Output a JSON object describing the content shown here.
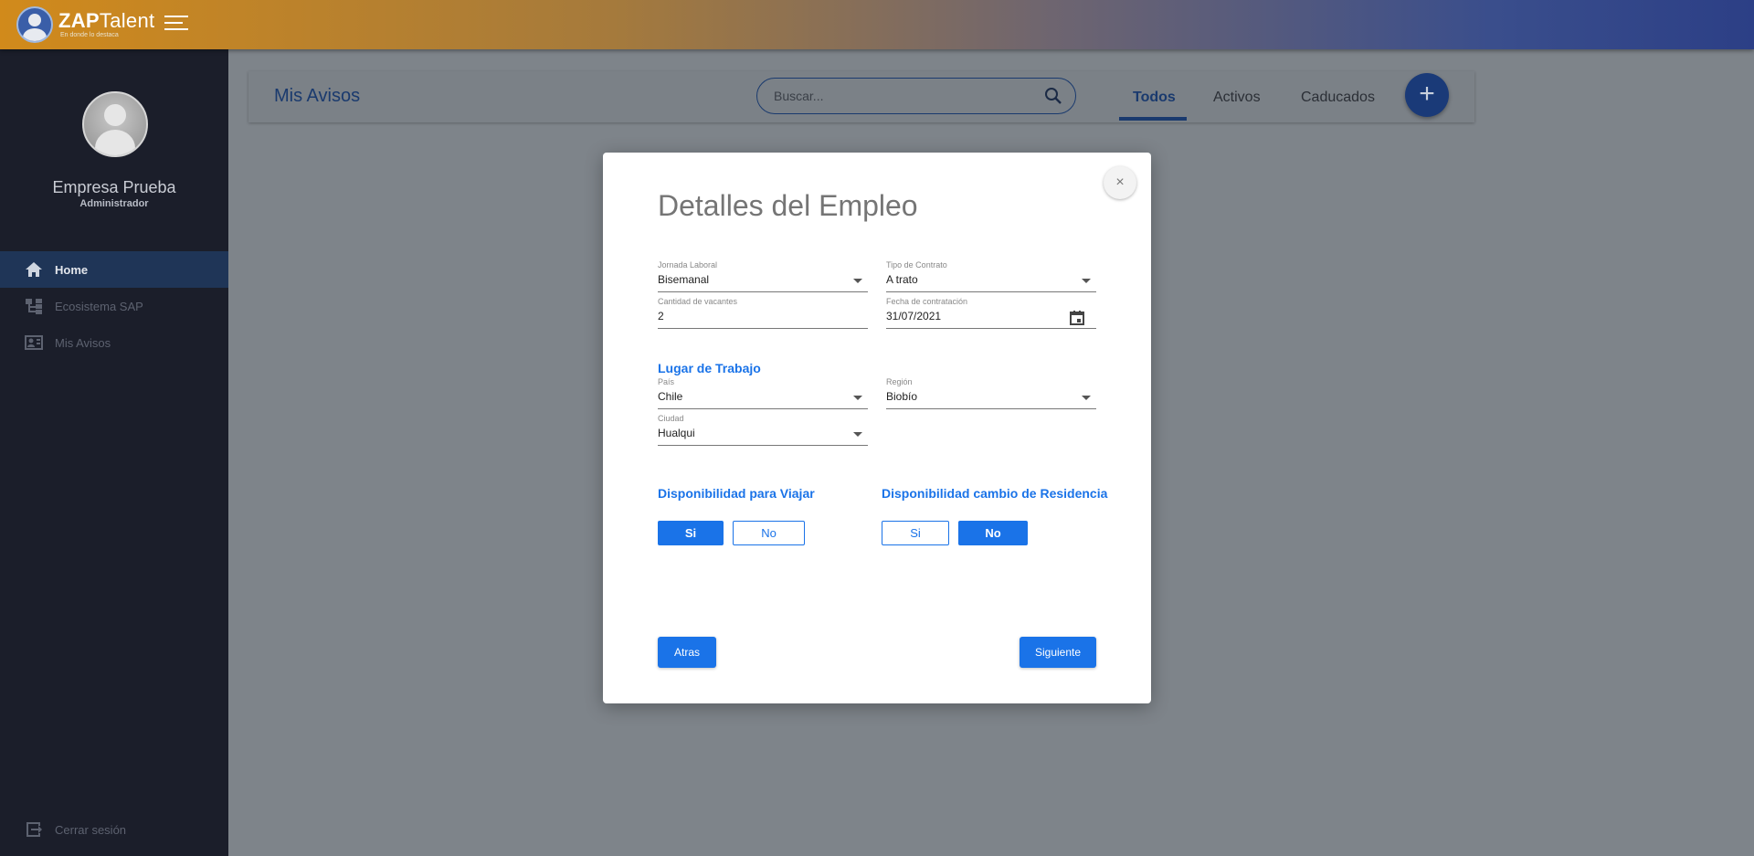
{
  "brand": {
    "name_bold": "ZAP",
    "name_thin": "Talent",
    "tagline": "En donde lo destaca"
  },
  "sidebar": {
    "company": "Empresa Prueba",
    "role": "Administrador",
    "items": [
      {
        "label": "Home",
        "icon": "home-icon",
        "active": true
      },
      {
        "label": "Ecosistema SAP",
        "icon": "tree-icon",
        "active": false
      },
      {
        "label": "Mis Avisos",
        "icon": "id-card-icon",
        "active": false
      }
    ],
    "logout": "Cerrar sesión"
  },
  "header": {
    "title": "Mis Avisos",
    "search_placeholder": "Buscar...",
    "tabs": [
      {
        "label": "Todos",
        "active": true
      },
      {
        "label": "Activos",
        "active": false
      },
      {
        "label": "Caducados",
        "active": false
      }
    ],
    "add_button": "+"
  },
  "modal": {
    "title": "Detalles del Empleo",
    "close": "×",
    "fields": {
      "jornada": {
        "label": "Jornada Laboral",
        "value": "Bisemanal"
      },
      "contrato": {
        "label": "Tipo de Contrato",
        "value": "A trato"
      },
      "vacantes": {
        "label": "Cantidad de vacantes",
        "value": "2"
      },
      "fecha": {
        "label": "Fecha de contratación",
        "value": "31/07/2021"
      },
      "pais": {
        "label": "País",
        "value": "Chile"
      },
      "region": {
        "label": "Región",
        "value": "Biobío"
      },
      "ciudad": {
        "label": "Ciudad",
        "value": "Hualqui"
      }
    },
    "sections": {
      "lugar": "Lugar de Trabajo",
      "viajar": "Disponibilidad para Viajar",
      "residencia": "Disponibilidad cambio de Residencia"
    },
    "viajar": {
      "yes": "Si",
      "no": "No",
      "selected": "Si"
    },
    "residencia": {
      "yes": "Si",
      "no": "No",
      "selected": "No"
    },
    "buttons": {
      "back": "Atras",
      "next": "Siguiente"
    }
  },
  "colors": {
    "accent": "#1a73e8",
    "sidebar_bg": "#1b1e2a",
    "header_accent": "#1a3a6e"
  }
}
